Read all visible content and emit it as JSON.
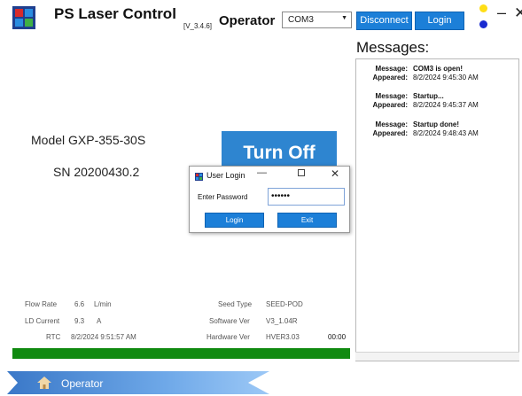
{
  "app": {
    "title": "PS Laser Control",
    "version": "[V_3.4.6]",
    "role": "Operator",
    "com_port": "COM3",
    "disconnect_label": "Disconnect",
    "login_label": "Login",
    "minimize_glyph": "–",
    "close_glyph": "✕"
  },
  "device": {
    "model": "Model GXP-355-30S",
    "sn": "SN 20200430.2",
    "turn_off_label": "Turn Off"
  },
  "messages": {
    "title": "Messages:",
    "key_message": "Message:",
    "key_appeared": "Appeared:",
    "items": [
      {
        "message": "COM3 is open!",
        "appeared": "8/2/2024 9:45:30 AM"
      },
      {
        "message": "Startup...",
        "appeared": "8/2/2024 9:45:37 AM"
      },
      {
        "message": "Startup done!",
        "appeared": "8/2/2024 9:48:43 AM"
      }
    ]
  },
  "status": {
    "flow_rate_label": "Flow Rate",
    "flow_rate_value": "6.6",
    "flow_rate_unit": "L/min",
    "ld_current_label": "LD Current",
    "ld_current_value": "9.3",
    "ld_current_unit": "A",
    "rtc_label": "RTC",
    "rtc_value": "8/2/2024 9:51:57 AM",
    "seed_type_label": "Seed Type",
    "seed_type_value": "SEED-POD",
    "software_ver_label": "Software Ver",
    "software_ver_value": "V3_1.04R",
    "hardware_ver_label": "Hardware Ver",
    "hardware_ver_value": "HVER3.03",
    "timer": "00:00",
    "progress": 1.0
  },
  "footer": {
    "operator_label": "Operator"
  },
  "login_dialog": {
    "title": "User Login",
    "password_label": "Enter Password",
    "password_value": "••••••",
    "login_label": "Login",
    "exit_label": "Exit"
  },
  "colors": {
    "accent": "#1c7fd8",
    "turn_off": "#2e85d0",
    "progress": "#108a10",
    "status_yellow": "#ffde16",
    "status_blue": "#1a2bd0"
  },
  "icons": {
    "app_logo": "app-logo-icon",
    "home": "home-icon",
    "dropdown": "chevron-down-icon"
  }
}
